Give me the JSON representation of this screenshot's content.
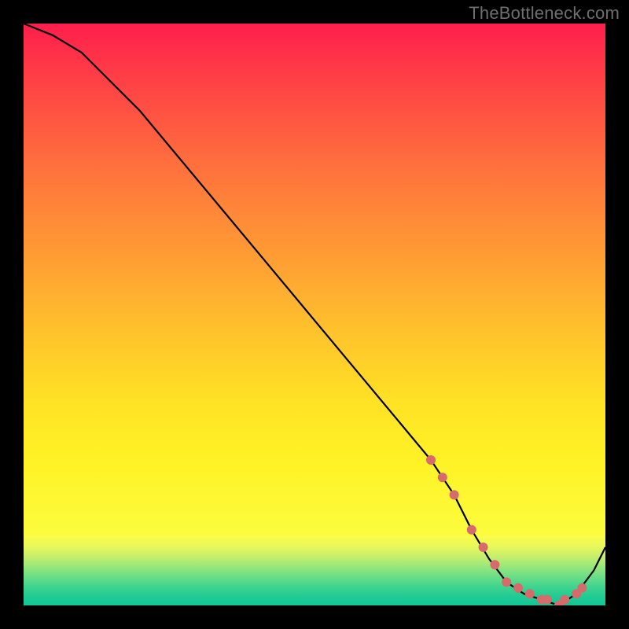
{
  "watermark": {
    "text": "TheBottleneck.com"
  },
  "chart_data": {
    "type": "line",
    "title": "",
    "xlabel": "",
    "ylabel": "",
    "xlim": [
      0,
      100
    ],
    "ylim": [
      0,
      100
    ],
    "background": {
      "gradient_stops": [
        {
          "pos": 0.0,
          "color": "#ff1e4c"
        },
        {
          "pos": 0.6,
          "color": "#ffc22c"
        },
        {
          "pos": 0.86,
          "color": "#fff326"
        },
        {
          "pos": 0.96,
          "color": "#67dd87"
        },
        {
          "pos": 1.0,
          "color": "#12c696"
        }
      ]
    },
    "series": [
      {
        "name": "bottleneck-curve",
        "color": "#000000",
        "x": [
          0,
          5,
          10,
          20,
          30,
          40,
          50,
          60,
          70,
          74,
          77,
          80,
          83,
          86,
          89,
          92,
          95,
          98,
          100
        ],
        "values": [
          100,
          98,
          95,
          85,
          73,
          61,
          49,
          37,
          25,
          19,
          13,
          8,
          4,
          2,
          1,
          0,
          2,
          6,
          10
        ]
      }
    ],
    "markers": {
      "name": "highlight-dots",
      "color": "#d76a6a",
      "radius_px": 6,
      "x": [
        70,
        72,
        74,
        77,
        79,
        81,
        83,
        85,
        87,
        89,
        90,
        92,
        93,
        95,
        96
      ],
      "values": [
        25,
        22,
        19,
        13,
        10,
        7,
        4,
        3,
        2,
        1,
        1,
        0,
        1,
        2,
        3
      ]
    }
  }
}
